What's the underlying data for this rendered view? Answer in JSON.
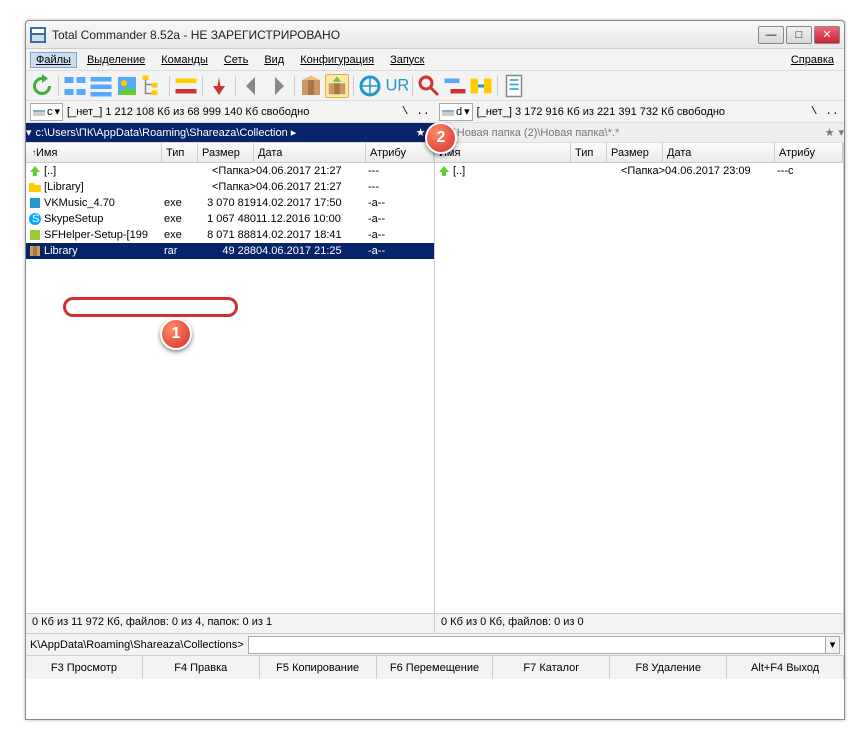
{
  "title": "Total Commander 8.52a - НЕ ЗАРЕГИСТРИРОВАНО",
  "menu": {
    "files": "Файлы",
    "selection": "Выделение",
    "commands": "Команды",
    "net": "Сеть",
    "view": "Вид",
    "config": "Конфигурация",
    "start": "Запуск",
    "help": "Справка"
  },
  "drives": {
    "left": {
      "letter": "c",
      "label": "[_нет_]",
      "info": "1 212 108 Кб из 68 999 140 Кб свободно"
    },
    "right": {
      "letter": "d",
      "label": "[_нет_]",
      "info": "3 172 916 Кб из 221 391 732 Кб свободно"
    }
  },
  "paths": {
    "left": "c:\\Users\\ПК\\AppData\\Roaming\\Shareaza\\Collection ▸",
    "right": "d:\\Новая папка (2)\\Новая папка\\*.*"
  },
  "columns": {
    "name": "Имя",
    "ext": "Тип",
    "size": "Размер",
    "date": "Дата",
    "attr": "Атрибу"
  },
  "left_files": [
    {
      "icon": "up",
      "name": "[..]",
      "ext": "",
      "size": "<Папка>",
      "date": "04.06.2017 21:27",
      "attr": "---"
    },
    {
      "icon": "folder",
      "name": "[Library]",
      "ext": "",
      "size": "<Папка>",
      "date": "04.06.2017 21:27",
      "attr": "---"
    },
    {
      "icon": "exe",
      "name": "VKMusic_4.70",
      "ext": "exe",
      "size": "3 070 819",
      "date": "14.02.2017 17:50",
      "attr": "-a--"
    },
    {
      "icon": "skype",
      "name": "SkypeSetup",
      "ext": "exe",
      "size": "1 067 480",
      "date": "11.12.2016 10:00",
      "attr": "-a--"
    },
    {
      "icon": "exe2",
      "name": "SFHelper-Setup-[199",
      "ext": "exe",
      "size": "8 071 888",
      "date": "14.02.2017 18:41",
      "attr": "-a--"
    },
    {
      "icon": "rar",
      "name": "Library",
      "ext": "rar",
      "size": "49 288",
      "date": "04.06.2017 21:25",
      "attr": "-a--"
    }
  ],
  "right_files": [
    {
      "icon": "up",
      "name": "[..]",
      "ext": "",
      "size": "<Папка>",
      "date": "04.06.2017 23:09",
      "attr": "---c"
    }
  ],
  "status": {
    "left": "0 Кб из 11 972 Кб, файлов: 0 из 4, папок: 0 из 1",
    "right": "0 Кб из 0 Кб, файлов: 0 из 0"
  },
  "cmdline": "K\\AppData\\Roaming\\Shareaza\\Collections>",
  "fkeys": {
    "f3": "F3 Просмотр",
    "f4": "F4 Правка",
    "f5": "F5 Копирование",
    "f6": "F6 Перемещение",
    "f7": "F7 Каталог",
    "f8": "F8 Удаление",
    "altf4": "Alt+F4 Выход"
  },
  "callouts": {
    "c1": "1",
    "c2": "2"
  }
}
